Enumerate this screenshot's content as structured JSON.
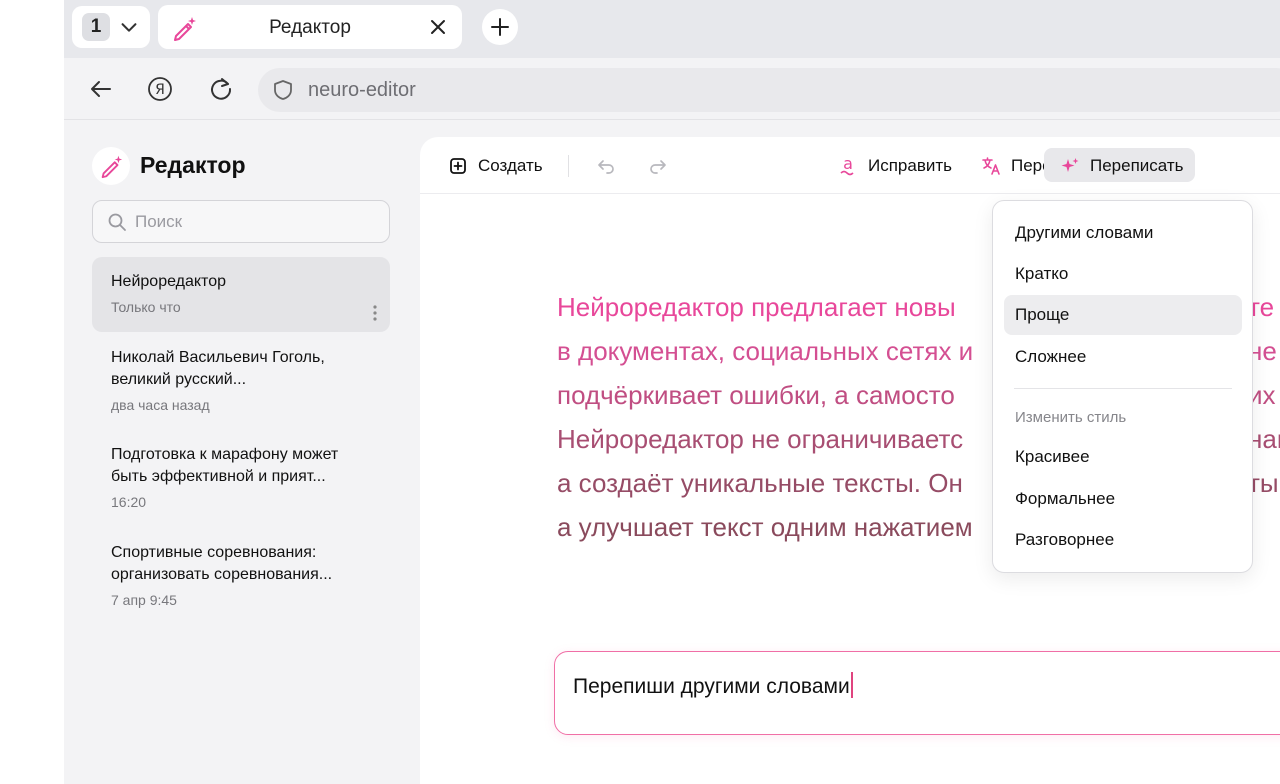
{
  "browser": {
    "tab_count": "1",
    "tab_title": "Редактор",
    "url": "neuro-editor"
  },
  "sidebar": {
    "title": "Редактор",
    "search_placeholder": "Поиск",
    "documents": [
      {
        "title_lines": [
          "Нейроредактор"
        ],
        "time": "Только что",
        "active": true
      },
      {
        "title_lines": [
          "Николай Васильевич Гоголь,",
          "великий русский..."
        ],
        "time": "два часа назад",
        "active": false
      },
      {
        "title_lines": [
          "Подготовка к марафону может",
          "быть эффективной и прият..."
        ],
        "time": "16:20",
        "active": false
      },
      {
        "title_lines": [
          "Спортивные соревнования:",
          "организовать соревнования..."
        ],
        "time": "7 апр 9:45",
        "active": false
      }
    ]
  },
  "toolbar": {
    "create": "Создать",
    "fix": "Исправить",
    "translate": "Перевести",
    "rewrite": "Переписать"
  },
  "document": {
    "lines": [
      "Нейроредактор предлагает новы",
      "в документах, социальных сетях и",
      "подчёркивает ошибки, а самосто",
      "Нейроредактор не ограничиваетс",
      "а создаёт уникальные тексты. Он",
      "а улучшает текст одним нажатием"
    ],
    "lines_right": [
      "те",
      "не",
      "их",
      "нам",
      "ты",
      ""
    ]
  },
  "prompt": {
    "text": "Перепиши другими словами"
  },
  "rewrite_menu": {
    "items": [
      "Другими словами",
      "Кратко",
      "Проще",
      "Сложнее"
    ],
    "highlighted": "Проще",
    "style_heading": "Изменить стиль",
    "style_items": [
      "Красивее",
      "Формальнее",
      "Разговорнее"
    ]
  },
  "colors": {
    "accent_pink": "#f06fa6",
    "text_gradient_start": "#e8479a",
    "text_gradient_end": "#8a4a5c"
  }
}
